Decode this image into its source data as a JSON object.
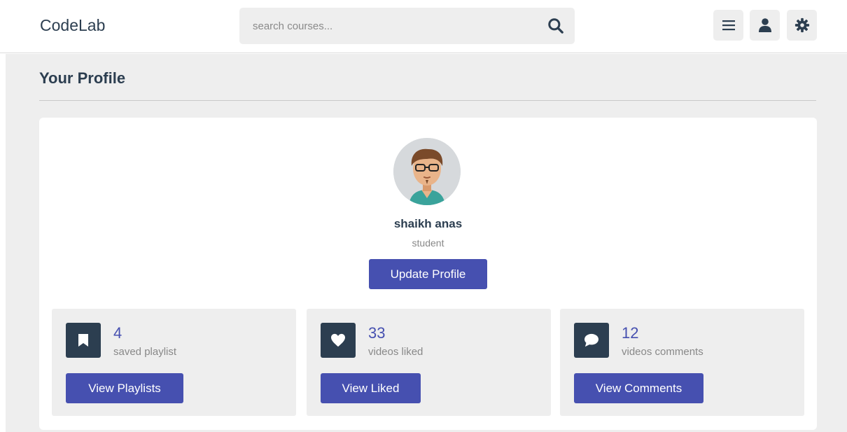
{
  "header": {
    "logo": "CodeLab",
    "search_placeholder": "search courses...",
    "icons": [
      "menu-icon",
      "user-icon",
      "settings-icon"
    ]
  },
  "page": {
    "title": "Your Profile"
  },
  "profile": {
    "name": "shaikh anas",
    "role": "student",
    "update_label": "Update Profile"
  },
  "stats": [
    {
      "count": "4",
      "label": "saved playlist",
      "button": "View Playlists",
      "icon": "bookmark-icon"
    },
    {
      "count": "33",
      "label": "videos liked",
      "button": "View Liked",
      "icon": "heart-icon"
    },
    {
      "count": "12",
      "label": "videos comments",
      "button": "View Comments",
      "icon": "comment-icon"
    }
  ],
  "colors": {
    "accent": "#4650b0",
    "dark": "#2c3e50",
    "panel": "#eeeeee"
  }
}
